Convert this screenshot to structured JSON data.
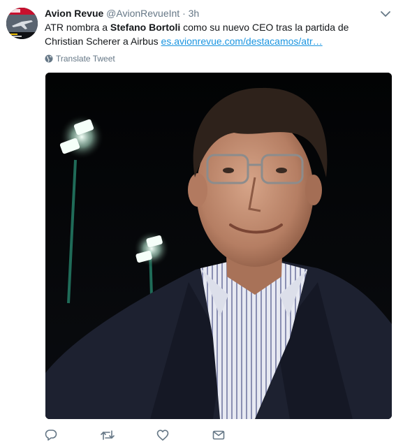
{
  "tweet": {
    "display_name": "Avion Revue",
    "handle": "@AvionRevueInt",
    "separator": "·",
    "time": "3h",
    "text_prefix": "ATR nombra a ",
    "text_bold": "Stefano Bortoli",
    "text_middle": " como su nuevo CEO tras la partida de Christian Scherer a Airbus ",
    "link_text": "es.avionrevue.com/destacamos/atr…",
    "translate_label": "Translate Tweet"
  },
  "icons": {
    "caret": "chevron-down-icon",
    "translate": "globe-icon",
    "actions": [
      "reply-icon",
      "retweet-icon",
      "like-icon",
      "message-icon"
    ]
  },
  "colors": {
    "link": "#1b95e0",
    "secondary_text": "#657786",
    "icon": "#657786"
  }
}
